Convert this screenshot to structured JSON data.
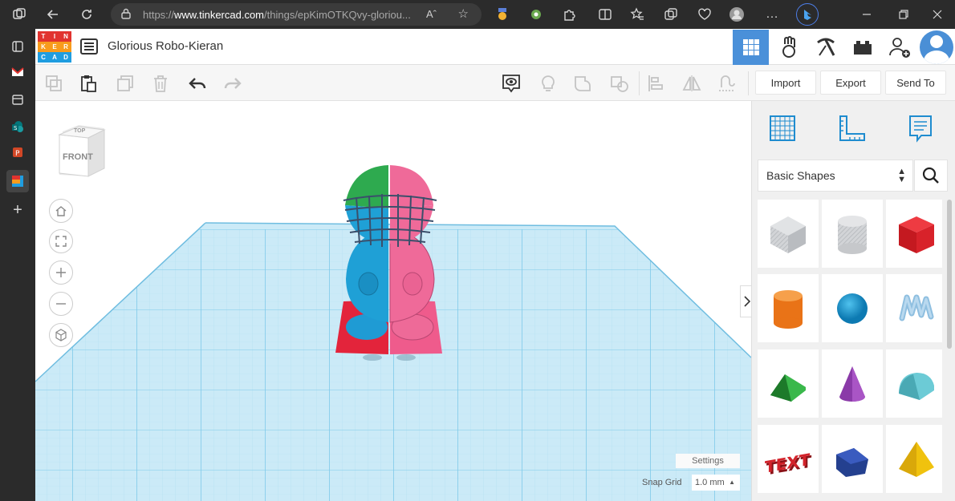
{
  "browser": {
    "url_prefix": "https://",
    "url_domain": "www.tinkercad.com",
    "url_path": "/things/epKimOTKQvy-gloriou...",
    "reader_icon": "Aˆ",
    "icons": [
      "tabs-icon",
      "back-icon",
      "reload-icon",
      "site-info-icon",
      "favorite-icon",
      "extension-icons",
      "bing-icon",
      "minimize-icon",
      "maximize-icon",
      "close-icon"
    ]
  },
  "app": {
    "logo_letters": [
      "T",
      "I",
      "N",
      "K",
      "E",
      "R",
      "C",
      "A",
      "D"
    ],
    "logo_colors": [
      "#e1332f",
      "#e1332f",
      "#e1332f",
      "#f89b1c",
      "#f89b1c",
      "#f89b1c",
      "#1f9de0",
      "#1f9de0",
      "#1f9de0"
    ],
    "design_title": "Glorious Robo-Kieran",
    "accent": "#4a90d9"
  },
  "toolbar": {
    "import_label": "Import",
    "export_label": "Export",
    "send_to_label": "Send To"
  },
  "workplane": {
    "viewcube_top": "TOP",
    "viewcube_front": "FRONT",
    "settings_label": "Settings",
    "snap_grid_label": "Snap Grid",
    "snap_grid_value": "1.0 mm",
    "grid_color": "#7ec9ea"
  },
  "panel": {
    "category": "Basic Shapes",
    "shapes": [
      {
        "name": "box-hole",
        "color": "#c7c9cc"
      },
      {
        "name": "cylinder-hole",
        "color": "#cfd1d3"
      },
      {
        "name": "box",
        "color": "#d71f26"
      },
      {
        "name": "cylinder",
        "color": "#f07f1e"
      },
      {
        "name": "sphere",
        "color": "#1596d0"
      },
      {
        "name": "scribble",
        "color": "#8fbfe0"
      },
      {
        "name": "roof",
        "color": "#2ea03a"
      },
      {
        "name": "cone",
        "color": "#8a3aa8"
      },
      {
        "name": "round-roof",
        "color": "#5bc3cf"
      },
      {
        "name": "text",
        "color": "#d3232b"
      },
      {
        "name": "polygon",
        "color": "#24408f"
      },
      {
        "name": "pyramid",
        "color": "#f0c20e"
      }
    ]
  }
}
